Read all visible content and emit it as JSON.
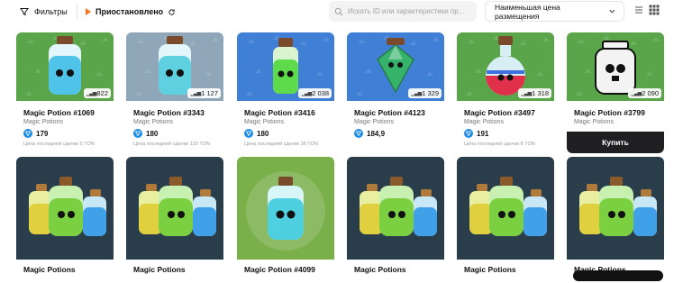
{
  "toolbar": {
    "filters_label": "Фильтры",
    "status_label": "Приостановлено",
    "search_placeholder": "Искать ID или характеристики пр...",
    "sort_label": "Наименьшая цена размещения",
    "icons": [
      "filter-icon",
      "play-icon",
      "refresh-icon",
      "search-icon",
      "chevron-down-icon",
      "list-view-icon",
      "grid-view-icon"
    ]
  },
  "colors": {
    "accent_orange": "#f97316",
    "ton_blue": "#1d8dea",
    "buy_button": "#1f1f22"
  },
  "row1": [
    {
      "title": "Magic Potion #1069",
      "collection": "Magic Potions",
      "volume": "822",
      "price": "179",
      "last_sale": "Цена последней сделки 5 TON",
      "bg": "#5aa54a",
      "liquid": "#4fc3e8",
      "type": "square"
    },
    {
      "title": "Magic Potion #3343",
      "collection": "Magic Potions",
      "volume": "1 127",
      "price": "180",
      "last_sale": "Цена последней сделки 120 TON",
      "bg": "#8fa7b8",
      "liquid": "#5fd0e0",
      "type": "square"
    },
    {
      "title": "Magic Potion #3416",
      "collection": "Magic Potions",
      "volume": "2 038",
      "price": "180",
      "last_sale": "Цена последней сделки 36 TON",
      "bg": "#3f7fd6",
      "liquid": "#5ddb4a",
      "type": "tall"
    },
    {
      "title": "Magic Potion #4123",
      "collection": "Magic Potions",
      "volume": "1 329",
      "price": "184,9",
      "last_sale": "",
      "bg": "#3f7fd6",
      "liquid": "#35b36a",
      "type": "gem"
    },
    {
      "title": "Magic Potion #3497",
      "collection": "Magic Potions",
      "volume": "1 318",
      "price": "191",
      "last_sale": "Цена последней сделки 8 TON",
      "bg": "#5aa54a",
      "liquid": "#e0304a",
      "type": "round"
    },
    {
      "title": "Magic Potion #3799",
      "collection": "Magic Potions",
      "volume": "2 090",
      "price": "",
      "last_sale": "",
      "bg": "#5aa54a",
      "liquid": "#f3f3f3",
      "type": "outline",
      "buy_label": "Купить"
    }
  ],
  "row2": [
    {
      "title": "Magic Potions",
      "bg": "#2a3d4a",
      "type": "trio"
    },
    {
      "title": "Magic Potions",
      "bg": "#2a3d4a",
      "type": "trio"
    },
    {
      "title": "Magic Potion #4099",
      "bg": "#7ab04a",
      "type": "single"
    },
    {
      "title": "Magic Potions",
      "bg": "#2a3d4a",
      "type": "trio"
    },
    {
      "title": "Magic Potions",
      "bg": "#2a3d4a",
      "type": "trio"
    },
    {
      "title": "Magic Potions",
      "bg": "#2a3d4a",
      "type": "trio"
    }
  ]
}
